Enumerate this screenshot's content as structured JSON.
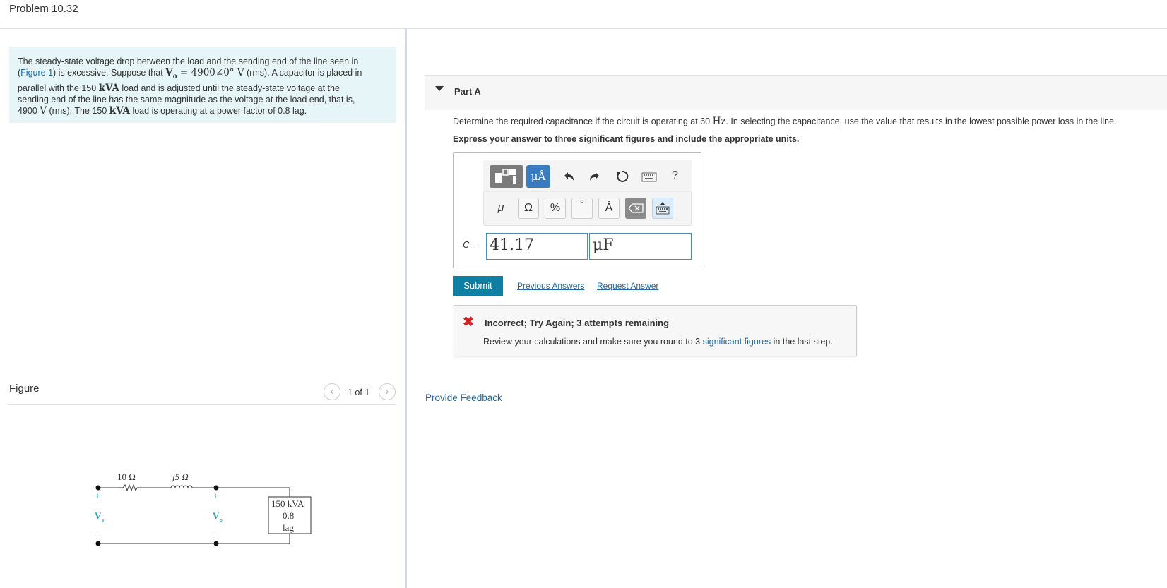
{
  "page": {
    "title": "Problem 10.32"
  },
  "problem": {
    "line1_a": "The steady-state voltage drop between the load and the sending end of the line seen in",
    "line2_link": "Figure 1",
    "line2_a": ") is excessive. Suppose that ",
    "vo_symbol": "V",
    "vo_sub": "o",
    "vo_value": " = 4900∠0° V",
    "line2_b": " (rms). A capacitor is placed in",
    "line3_a": "parallel with the 150 ",
    "kva": "kVA",
    "line3_b": " load and is adjusted until the steady-state voltage at the",
    "line4": "sending end of the line has the same magnitude as the voltage at the load end, that is,",
    "line5_a": "4900 ",
    "v_unit": "V",
    "line5_b": " (rms). The 150 ",
    "line5_c": " load is operating at a power factor of 0.8 lag."
  },
  "figure": {
    "label": "Figure",
    "pager": "1 of 1",
    "prev_icon": "chevron-left-icon",
    "next_icon": "chevron-right-icon",
    "circuit": {
      "r_label": "10 Ω",
      "x_label": "j5 Ω",
      "vs_label": "V",
      "vs_sub": "s",
      "vo_label": "V",
      "vo_sub": "o",
      "plus": "+",
      "minus": "–",
      "load_line1": "150 kVA",
      "load_line2": "0.8",
      "load_line3": "lag"
    }
  },
  "part_a": {
    "title": "Part A",
    "question_a": "Determine the required capacitance if the circuit is operating at 60 ",
    "hz": "Hz",
    "question_b": ". In selecting the capacitance, use the value that results in the lowest possible power loss in the line.",
    "express": "Express your answer to three significant figures and include the appropriate units.",
    "toolbar": {
      "units_label": "μÅ",
      "help_label": "?",
      "mu": "μ",
      "ohm": "Ω",
      "percent": "%",
      "degree": "°",
      "angstrom": "Å"
    },
    "answer": {
      "label": "C =",
      "value": "41.17",
      "units": "μF"
    },
    "submit_label": "Submit",
    "previous_answers": "Previous Answers",
    "request_answer": "Request Answer",
    "feedback": {
      "title": "Incorrect; Try Again; 3 attempts remaining",
      "review_a": "Review your calculations and make sure you round to 3 ",
      "review_link": "significant figures",
      "review_b": " in the last step."
    },
    "provide_feedback": "Provide Feedback"
  },
  "colors": {
    "problem_bg": "#e6f5f7",
    "link": "#1f6aa5",
    "submit_bg": "#0f7ea3",
    "error": "#d21f1f",
    "units_btn": "#3a7bbf"
  }
}
